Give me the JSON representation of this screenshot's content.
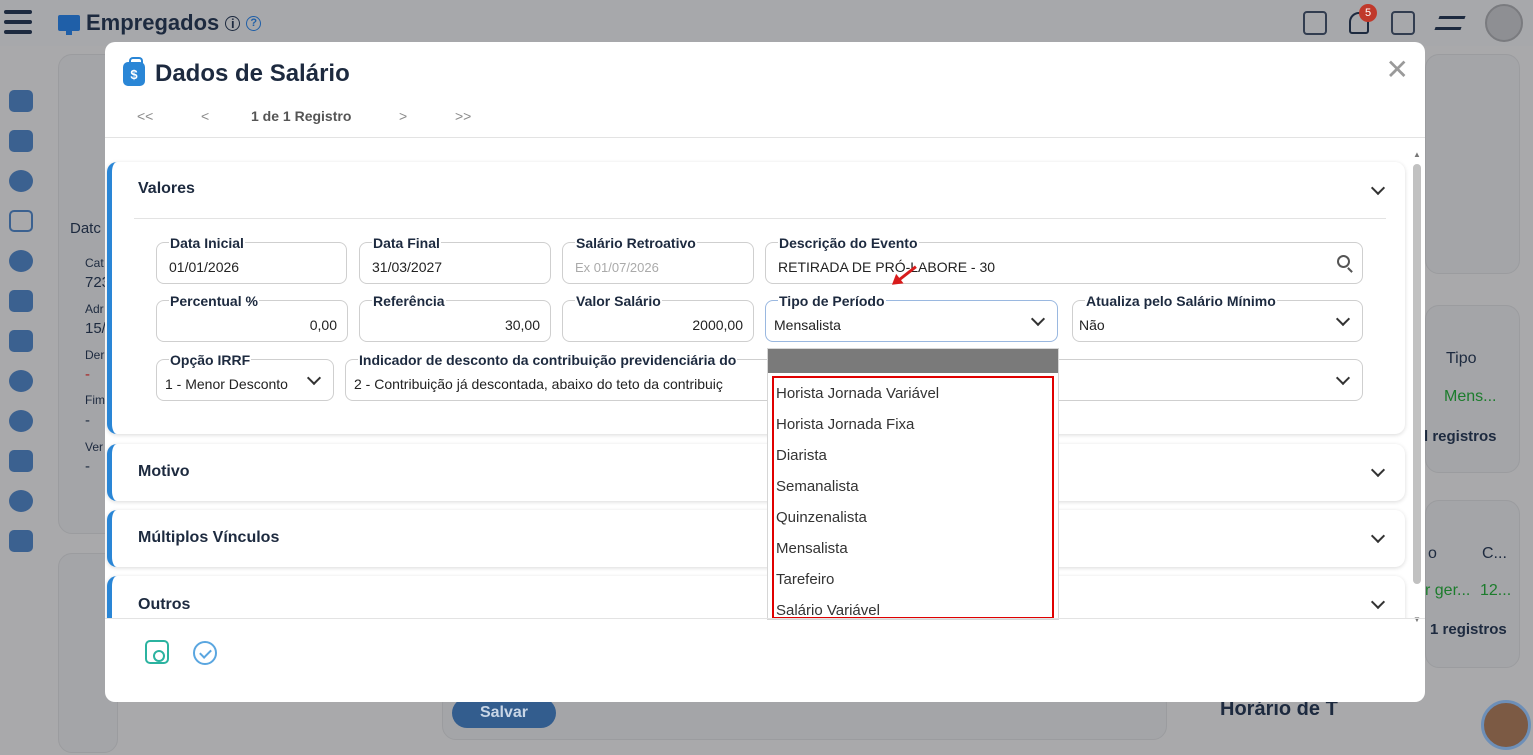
{
  "app": {
    "title": "Empregados",
    "notif_count": "5"
  },
  "background": {
    "left_texts": [
      "Datc",
      "Cat",
      "723",
      "Adr",
      "15/",
      "Der",
      "-",
      "Fim",
      "-",
      "Ver",
      "-"
    ],
    "right_texts": {
      "tipo": "Tipo",
      "mens": "Mens...",
      "reg1": "l registros",
      "o": "o",
      "c": "C...",
      "ger": "r ger...",
      "n12": "12...",
      "reg2": "1 registros",
      "horario": "Horário de T"
    },
    "save_label": "Salvar"
  },
  "modal": {
    "title": "Dados de Salário",
    "pager": {
      "first": "<<",
      "prev": "<",
      "text": "1 de 1 Registro",
      "next": ">",
      "last": ">>"
    },
    "sections": {
      "valores": "Valores",
      "motivo": "Motivo",
      "multiplos": "Múltiplos Vínculos",
      "outros": "Outros"
    },
    "fields": {
      "data_inicial": {
        "label": "Data Inicial",
        "value": "01/01/2026"
      },
      "data_final": {
        "label": "Data Final",
        "value": "31/03/2027"
      },
      "salario_retroativo": {
        "label": "Salário Retroativo",
        "placeholder": "Ex 01/07/2026"
      },
      "descricao_evento": {
        "label": "Descrição do Evento",
        "value": "RETIRADA DE PRÓ-LABORE - 30"
      },
      "percentual": {
        "label": "Percentual %",
        "value": "0,00"
      },
      "referencia": {
        "label": "Referência",
        "value": "30,00"
      },
      "valor_salario": {
        "label": "Valor Salário",
        "value": "2000,00"
      },
      "tipo_periodo": {
        "label": "Tipo de Período",
        "value": "Mensalista"
      },
      "atualiza_minimo": {
        "label": "Atualiza pelo Salário Mínimo",
        "value": "Não"
      },
      "opcao_irrf": {
        "label": "Opção IRRF",
        "value": "1 - Menor Desconto"
      },
      "indicador_desconto": {
        "label": "Indicador de desconto da contribuição previdenciária do",
        "value": "2 - Contribuição já descontada, abaixo do teto da contribuiç"
      }
    },
    "dropdown_options": [
      "Horista Jornada Variável",
      "Horista Jornada Fixa",
      "Diarista",
      "Semanalista",
      "Quinzenalista",
      "Mensalista",
      "Tarefeiro",
      "Salário Variável"
    ]
  }
}
